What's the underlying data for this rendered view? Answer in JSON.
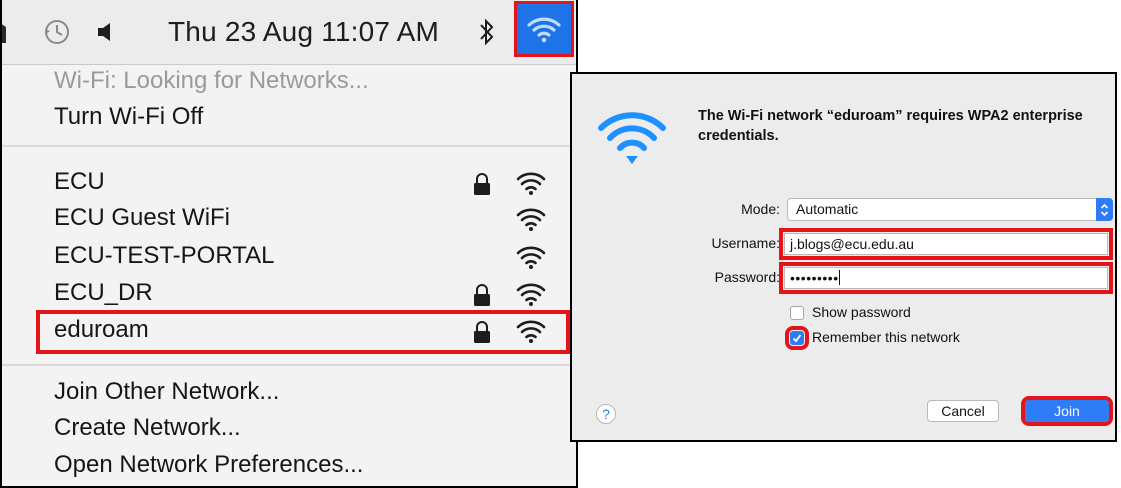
{
  "menubar": {
    "clock": "Thu 23 Aug  11:07 AM",
    "icons": [
      "app-icon",
      "time-machine-icon",
      "volume-icon",
      "bluetooth-icon",
      "wifi-icon"
    ]
  },
  "wifi_menu": {
    "status": "Wi-Fi: Looking for Networks...",
    "turn_off": "Turn Wi-Fi Off",
    "networks": [
      {
        "name": "ECU",
        "locked": true
      },
      {
        "name": "ECU Guest WiFi",
        "locked": false
      },
      {
        "name": "ECU-TEST-PORTAL",
        "locked": false
      },
      {
        "name": "ECU_DR",
        "locked": true
      },
      {
        "name": "eduroam",
        "locked": true
      }
    ],
    "join_other": "Join Other Network...",
    "create_network": "Create Network...",
    "open_prefs": "Open Network Preferences..."
  },
  "dialog": {
    "message": "The Wi-Fi network “eduroam” requires WPA2 enterprise credentials.",
    "mode_label": "Mode:",
    "mode_value": "Automatic",
    "username_label": "Username:",
    "username_value": "j.blogs@ecu.edu.au",
    "password_label": "Password:",
    "password_value": "•••••••••",
    "show_password": "Show password",
    "show_password_checked": false,
    "remember_network": "Remember this network",
    "remember_network_checked": true,
    "help": "?",
    "cancel": "Cancel",
    "join": "Join"
  },
  "colors": {
    "accent": "#2e7cf6",
    "highlight": "#e3151a",
    "wifi_blue": "#1e90ff"
  }
}
